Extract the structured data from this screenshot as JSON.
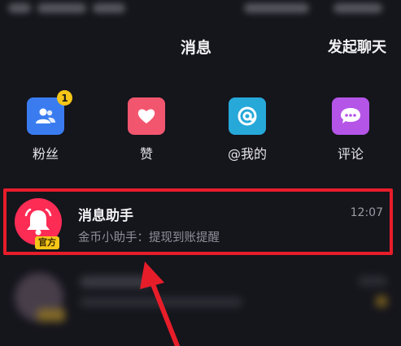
{
  "header": {
    "title": "消息",
    "action": "发起聊天"
  },
  "categories": [
    {
      "label": "粉丝",
      "icon": "fans-icon",
      "color": "#3a7cf0",
      "badge": "1"
    },
    {
      "label": "赞",
      "icon": "heart-icon",
      "color": "#f2566e"
    },
    {
      "label": "@我的",
      "icon": "at-icon",
      "color": "#26a8d9"
    },
    {
      "label": "评论",
      "icon": "comment-icon",
      "color": "#b455e8"
    }
  ],
  "message": {
    "name": "消息助手",
    "preview": "金币小助手：提现到账提醒",
    "time": "12:07",
    "tag": "官方",
    "avatar_icon": "bell-icon",
    "avatar_color": "#fd2c55"
  },
  "colors": {
    "background": "#15151c",
    "highlight": "#e81d2a",
    "arrow": "#e81d2a"
  }
}
